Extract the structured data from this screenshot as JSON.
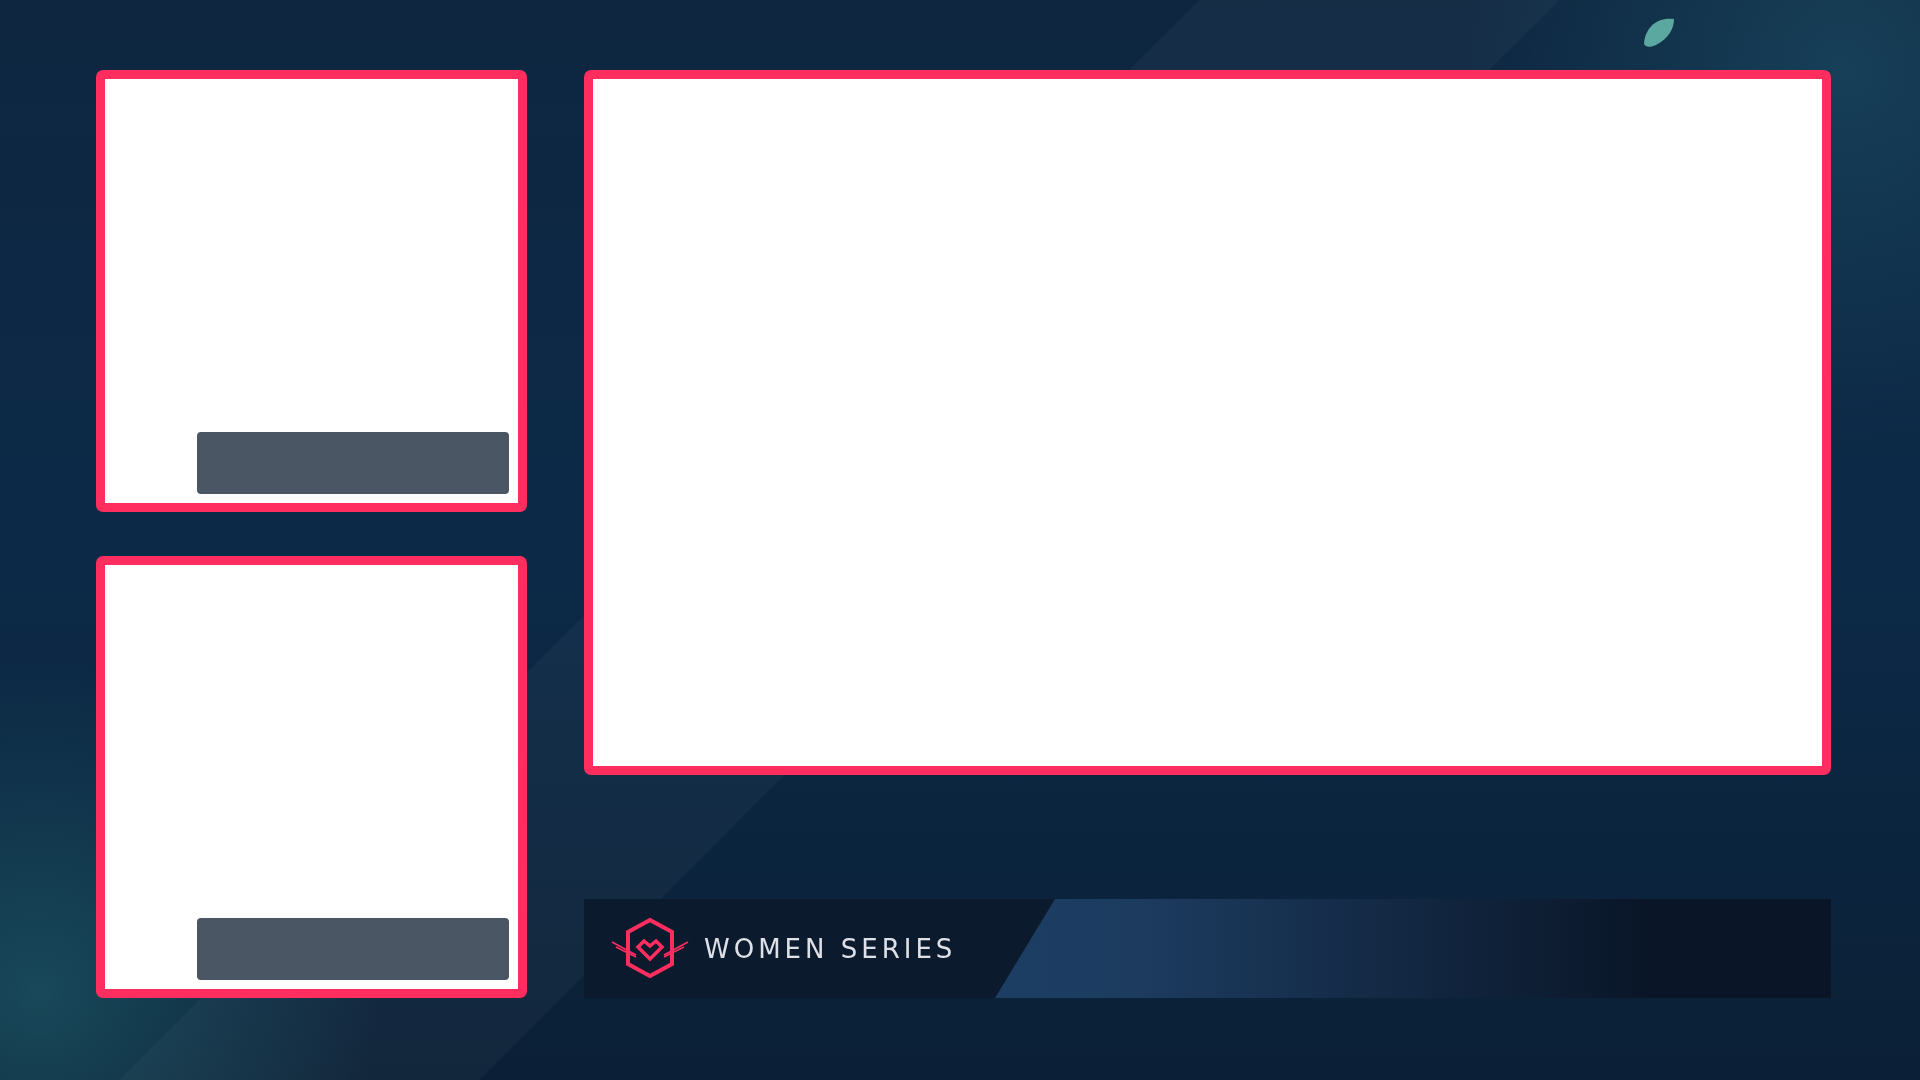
{
  "panels": [
    {
      "kind": "camera"
    },
    {
      "kind": "camera"
    },
    {
      "kind": "gameplay"
    }
  ],
  "banner": {
    "title": "WOMEN SERIES"
  }
}
